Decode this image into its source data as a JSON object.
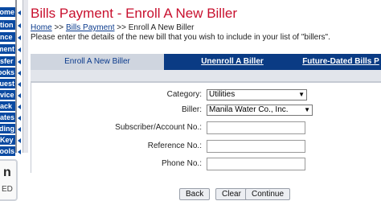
{
  "sidebar": {
    "items": [
      {
        "label": "ome"
      },
      {
        "label": "tion"
      },
      {
        "label": "nce"
      },
      {
        "label": "ment"
      },
      {
        "label": "sfer"
      },
      {
        "label": "ooks"
      },
      {
        "label": "uest"
      },
      {
        "label": "vice"
      },
      {
        "label": "ack"
      },
      {
        "label": "ates"
      },
      {
        "label": "ding"
      },
      {
        "label": "Key"
      },
      {
        "label": "ools"
      }
    ],
    "badge_top": "n",
    "badge_bottom": "ED"
  },
  "header": {
    "title": "Bills Payment - Enroll A New Biller",
    "breadcrumb": {
      "home": "Home",
      "sep1": ">>",
      "bills": "Bills Payment",
      "sep2": ">>",
      "current": "Enroll A New Biller"
    },
    "description": "Please enter the details of the new bill that you wish to include in your list of \"billers\"."
  },
  "tabs": [
    {
      "label": "Enroll A New Biller"
    },
    {
      "label": "Unenroll A Biller"
    },
    {
      "label": "Future-Dated Bills P"
    }
  ],
  "form": {
    "category_label": "Category:",
    "category_value": "Utilities",
    "biller_label": "Biller:",
    "biller_value": "Manila Water Co., Inc.",
    "subscriber_label": "Subscriber/Account No.:",
    "subscriber_value": "",
    "reference_label": "Reference No.:",
    "reference_value": "",
    "phone_label": "Phone No.:",
    "phone_value": ""
  },
  "buttons": {
    "back": "Back",
    "clear": "Clear",
    "continue": "Continue"
  },
  "colors": {
    "title": "#c8102e",
    "nav": "#0a4aa2",
    "tab_dark": "#0a3b84",
    "tab_active": "#cfd5df"
  }
}
